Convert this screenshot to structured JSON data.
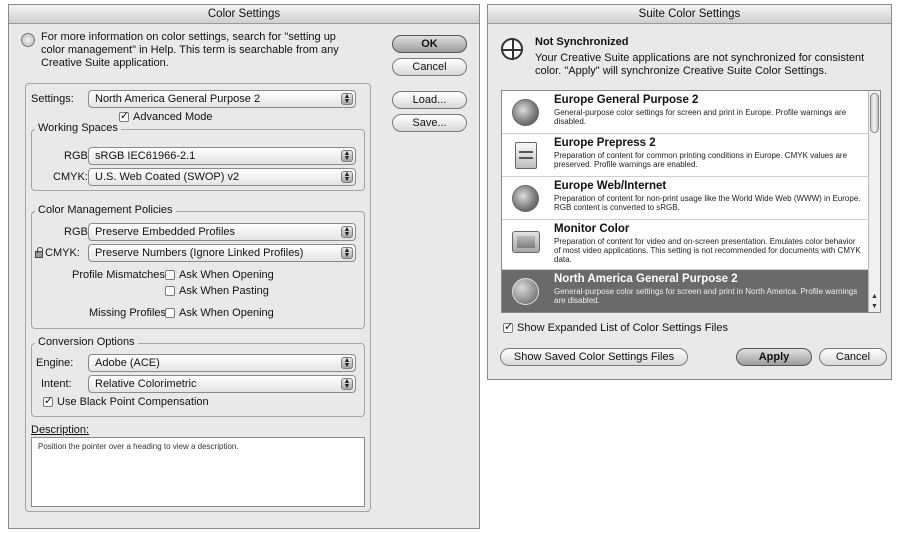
{
  "left_dialog": {
    "title": "Color Settings",
    "info_text_lines": [
      "For more information on color settings, search for \"setting up",
      "color management\" in Help. This term is searchable from any",
      "Creative Suite application."
    ],
    "buttons": {
      "ok": "OK",
      "cancel": "Cancel",
      "load": "Load...",
      "save": "Save..."
    },
    "settings_label": "Settings:",
    "settings_value": "North America General Purpose 2",
    "advanced_mode": {
      "label": "Advanced Mode",
      "checked": true
    },
    "working_spaces": {
      "title": "Working Spaces",
      "rgb_label": "RGB:",
      "rgb_value": "sRGB IEC61966-2.1",
      "cmyk_label": "CMYK:",
      "cmyk_value": "U.S. Web Coated (SWOP) v2"
    },
    "policies": {
      "title": "Color Management Policies",
      "rgb_label": "RGB:",
      "rgb_value": "Preserve Embedded Profiles",
      "cmyk_label": "CMYK:",
      "cmyk_value": "Preserve Numbers (Ignore Linked Profiles)",
      "profile_mismatches_label": "Profile Mismatches:",
      "ask_when_opening": "Ask When Opening",
      "ask_when_pasting": "Ask When Pasting",
      "missing_profiles_label": "Missing Profiles:",
      "missing_ask_when_opening": "Ask When Opening"
    },
    "conversion": {
      "title": "Conversion Options",
      "engine_label": "Engine:",
      "engine_value": "Adobe (ACE)",
      "intent_label": "Intent:",
      "intent_value": "Relative Colorimetric",
      "black_point": {
        "label": "Use Black Point Compensation",
        "checked": true
      }
    },
    "description": {
      "label": "Description:",
      "text": "Position the pointer over a heading to view a description."
    }
  },
  "right_dialog": {
    "title": "Suite Color Settings",
    "status_title": "Not Synchronized",
    "status_lines": [
      "Your Creative Suite applications are not synchronized for consistent",
      "color.  \"Apply\" will synchronize Creative Suite Color Settings."
    ],
    "items": [
      {
        "title": "Europe General Purpose 2",
        "desc": "General-purpose color settings for screen and print in Europe. Profile warnings are disabled.",
        "icon": "globe-icon",
        "selected": false
      },
      {
        "title": "Europe Prepress 2",
        "desc": "Preparation of content for common printing conditions in Europe. CMYK values are preserved. Profile warnings are enabled.",
        "icon": "document-icon",
        "selected": false
      },
      {
        "title": "Europe Web/Internet",
        "desc": "Preparation of content for non-print usage like the World Wide Web (WWW) in Europe. RGB content is converted to sRGB.",
        "icon": "globe-icon",
        "selected": false
      },
      {
        "title": "Monitor Color",
        "desc": "Preparation of content for video and on-screen presentation. Emulates color behavior of most video applications. This setting is not recommended for documents with CMYK data.",
        "icon": "monitor-icon",
        "selected": false
      },
      {
        "title": "North America General Purpose 2",
        "desc": "General-purpose color settings for screen and print in North America. Profile warnings are disabled.",
        "icon": "globe-icon",
        "selected": true
      }
    ],
    "show_expanded": {
      "label": "Show Expanded List of Color Settings Files",
      "checked": true
    },
    "buttons": {
      "show_saved": "Show Saved Color Settings Files",
      "apply": "Apply",
      "cancel": "Cancel"
    }
  }
}
